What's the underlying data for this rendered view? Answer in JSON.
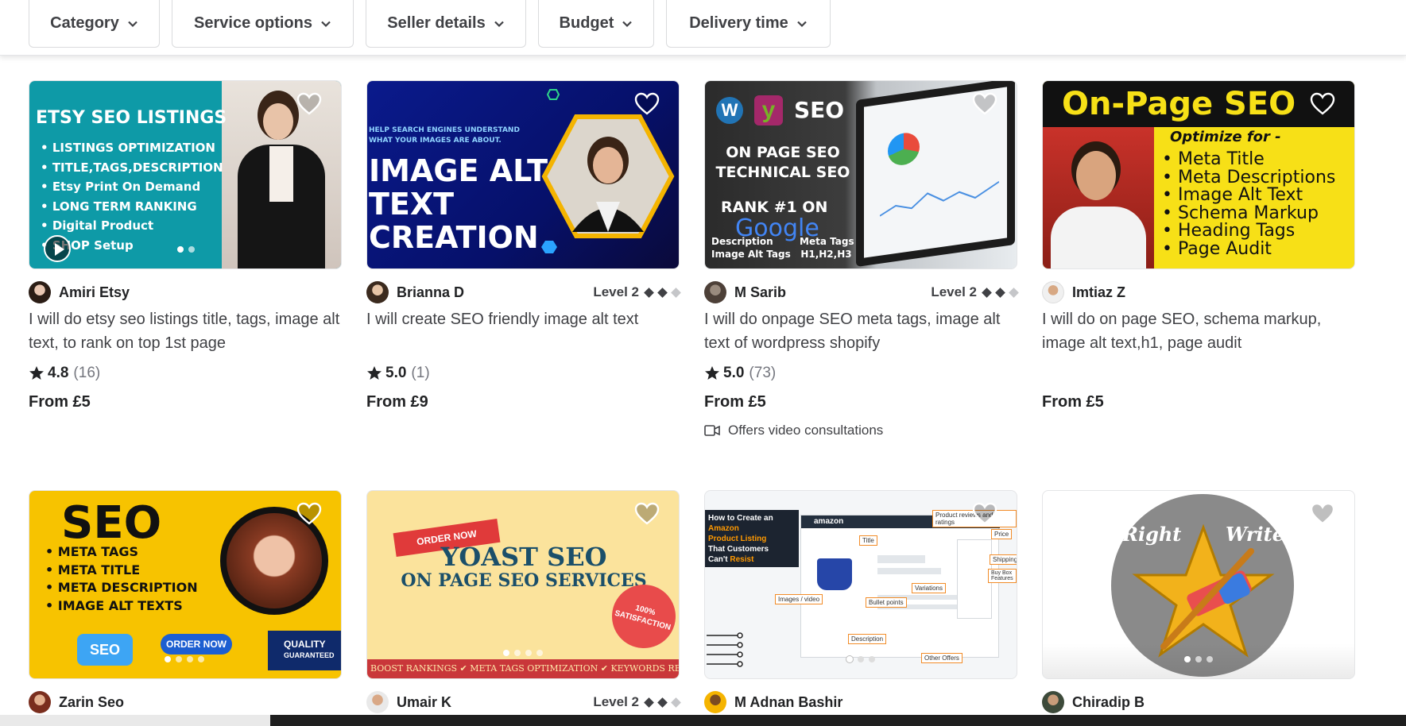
{
  "filters": [
    "Category",
    "Service options",
    "Seller details",
    "Budget",
    "Delivery time"
  ],
  "gigs": [
    {
      "seller": "Amiri Etsy",
      "level": "",
      "title": "I will do etsy seo listings title, tags, image alt text, to rank on top 1st page",
      "rating": "4.8",
      "reviews": "(16)",
      "price": "From £5",
      "consult": "",
      "thumb": {
        "bg": "#0e9aa7",
        "headline": "ETSY SEO LISTINGS",
        "bullets": [
          "LISTINGS OPTIMIZATION",
          "TITLE,TAGS,DESCRIPTION",
          "Etsy Print On Demand",
          "LONG TERM RANKING",
          "Digital Product",
          "SHOP Setup"
        ]
      }
    },
    {
      "seller": "Brianna D",
      "level": "Level 2",
      "title": "I will create SEO friendly image alt text",
      "rating": "5.0",
      "reviews": "(1)",
      "price": "From £9",
      "consult": "",
      "thumb": {
        "bg": "#0a1a8c",
        "tagline": "HELP SEARCH ENGINES UNDERSTAND WHAT YOUR IMAGES ARE ABOUT.",
        "headline": [
          "IMAGE ALT",
          "TEXT",
          "CREATION"
        ]
      }
    },
    {
      "seller": "M Sarib",
      "level": "Level 2",
      "title": "I will do onpage SEO meta tags, image alt text of wordpress shopify",
      "rating": "5.0",
      "reviews": "(73)",
      "price": "From £5",
      "consult": "Offers video consultations",
      "thumb": {
        "bg": "#3a3a3a",
        "logos": "SEO",
        "lines": [
          "ON PAGE SEO",
          "TECHNICAL SEO",
          "RANK #1 ON",
          "Google"
        ],
        "captions": [
          "Description",
          "Meta Tags",
          "Image Alt Tags",
          "H1,H2,H3"
        ]
      }
    },
    {
      "seller": "Imtiaz Z",
      "level": "",
      "title": "I will do on page SEO, schema markup, image alt text,h1, page audit",
      "rating": "",
      "reviews": "",
      "price": "From £5",
      "consult": "",
      "thumb": {
        "bg": "#f7e017",
        "headline": "On-Page SEO",
        "sub": "Optimize for -",
        "bullets": [
          "Meta Title",
          "Meta Descriptions",
          "Image Alt Text",
          "Schema Markup",
          "Heading Tags",
          "Page Audit"
        ]
      }
    },
    {
      "seller": "Zarin Seo",
      "level": "",
      "title": "",
      "rating": "",
      "reviews": "",
      "price": "",
      "consult": "",
      "thumb": {
        "bg": "#f7c300",
        "headline": "SEO",
        "bullets": [
          "META TAGS",
          "META TITLE",
          "META DESCRIPTION",
          "IMAGE ALT TEXTS"
        ],
        "cta": "ORDER NOW",
        "badge": [
          "QUALITY",
          "GUARANTEED"
        ]
      }
    },
    {
      "seller": "Umair K",
      "level": "Level 2",
      "title": "",
      "rating": "",
      "reviews": "",
      "price": "",
      "consult": "",
      "thumb": {
        "bg": "#fbe39c",
        "ribbon": "ORDER NOW",
        "headline": [
          "YOAST SEO",
          "ON PAGE SEO SERVICES"
        ],
        "seal": [
          "100%",
          "SATISFACTION"
        ],
        "footer": "BOOST RANKINGS ✔ META TAGS OPTIMIZATION ✔ KEYWORDS RESEA"
      }
    },
    {
      "seller": "M Adnan Bashir",
      "level": "",
      "title": "",
      "rating": "",
      "reviews": "",
      "price": "",
      "consult": "",
      "thumb": {
        "bg": "#f4f6f8",
        "caption": [
          "How to Create an",
          "Amazon",
          "Product Listing",
          "That Customers",
          "Can't",
          "Resist"
        ],
        "brand": "amazon",
        "callouts": [
          "Title",
          "Product reviews and ratings",
          "Price",
          "Shipping",
          "Buy Box Features",
          "Variations",
          "Images / video",
          "Bullet points",
          "Description",
          "Other Offers"
        ]
      }
    },
    {
      "seller": "Chiradip B",
      "level": "",
      "title": "",
      "rating": "",
      "reviews": "",
      "price": "",
      "consult": "",
      "thumb": {
        "bg": "#ffffff",
        "words": [
          "Right",
          "Write"
        ]
      }
    }
  ]
}
